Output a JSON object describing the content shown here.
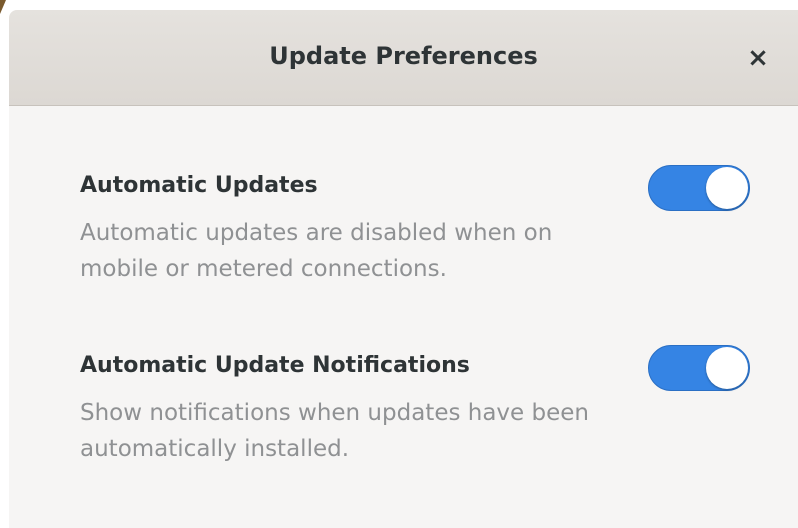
{
  "dialog": {
    "title": "Update Preferences",
    "close_label": "×"
  },
  "preferences": [
    {
      "title": "Automatic Updates",
      "description": "Automatic updates are disabled when on mobile or metered connections.",
      "enabled": true
    },
    {
      "title": "Automatic Update Notifications",
      "description": "Show notifications when updates have been automatically installed.",
      "enabled": true
    }
  ],
  "colors": {
    "switch_on": "#3584e4",
    "titlebar": "#dcd8d3",
    "background": "#f6f5f4",
    "primary_text": "#2e3436",
    "secondary_text": "#8f9193"
  }
}
